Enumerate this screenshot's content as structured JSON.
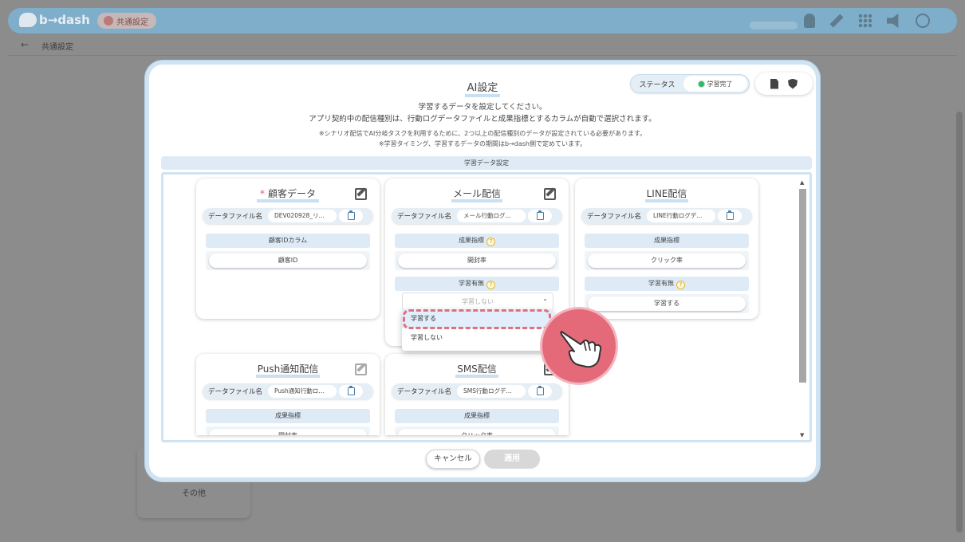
{
  "app": {
    "logo": "b→dash",
    "badge": "共通設定",
    "breadcrumb": "共通設定",
    "left_menu_item": "その他"
  },
  "modal": {
    "title": "AI設定",
    "status_label": "ステータス",
    "status_value": "学習完了",
    "desc_line1": "学習するデータを設定してください。",
    "desc_line2": "アプリ契約中の配信種別は、行動ログデータファイルと成果指標とするカラムが自動で選択されます。",
    "note_line1": "※シナリオ配信でAI分岐タスクを利用するために、2つ以上の配信種別のデータが設定されている必要があります。",
    "note_line2": "※学習タイミング、学習するデータの期間はb→dash側で定めています。",
    "section": "学習データ設定",
    "cancel": "キャンセル",
    "apply": "適用"
  },
  "file_label": "データファイル名",
  "cards": {
    "customer": {
      "title": "顧客データ",
      "file": "DEV020928_リ...",
      "field1_head": "顧客IDカラム",
      "field1_val": "顧客ID"
    },
    "mail": {
      "title": "メール配信",
      "file": "メール行動ログ...",
      "field1_head": "成果指標",
      "field1_val": "開封率",
      "field2_head": "学習有無",
      "field2_val": "学習しない"
    },
    "line": {
      "title": "LINE配信",
      "file": "LINE行動ログデ...",
      "field1_head": "成果指標",
      "field1_val": "クリック率",
      "field2_head": "学習有無",
      "field2_val": "学習する"
    },
    "push": {
      "title": "Push通知配信",
      "file": "Push通知行動ロ...",
      "field1_head": "成果指標",
      "field1_val": "開封率"
    },
    "sms": {
      "title": "SMS配信",
      "file": "SMS行動ログデ...",
      "field1_head": "成果指標",
      "field1_val": "クリック率"
    }
  },
  "dropdown": {
    "options": [
      "学習する",
      "学習しない"
    ],
    "selected": "学習しない"
  },
  "colors": {
    "accent": "#cfe3f2",
    "highlight": "#e0707f",
    "status": "#37b36b"
  },
  "icons": [
    "bell-icon",
    "wrench-icon",
    "grid-icon",
    "megaphone-icon",
    "sign-in-icon",
    "document-icon",
    "shield-icon",
    "edit-icon",
    "clipboard-icon",
    "help-icon",
    "pointing-hand-icon"
  ]
}
